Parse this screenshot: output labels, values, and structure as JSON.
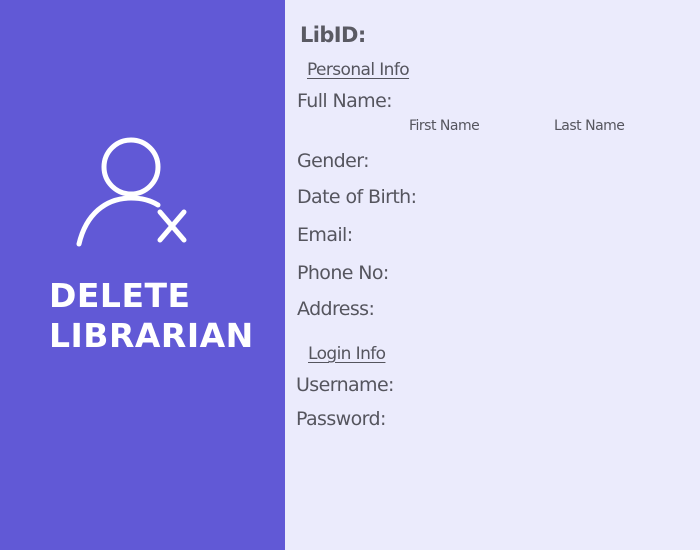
{
  "sidebar": {
    "title_line1": "DELETE",
    "title_line2": "LIBRARIAN",
    "icon": "user-remove-icon"
  },
  "form": {
    "lib_id_label": "LibID:",
    "personal_section": "Personal Info",
    "full_name_label": "Full Name:",
    "first_name_label": "First Name",
    "last_name_label": "Last Name",
    "gender_label": "Gender:",
    "dob_label": "Date of Birth:",
    "email_label": "Email:",
    "phone_label": "Phone No:",
    "address_label": "Address:",
    "login_section": "Login Info",
    "username_label": "Username:",
    "password_label": "Password:"
  },
  "colors": {
    "sidebar_bg": "#6159d6",
    "panel_bg": "#ebebfc",
    "text": "#55555e",
    "sidebar_text": "#ffffff"
  }
}
